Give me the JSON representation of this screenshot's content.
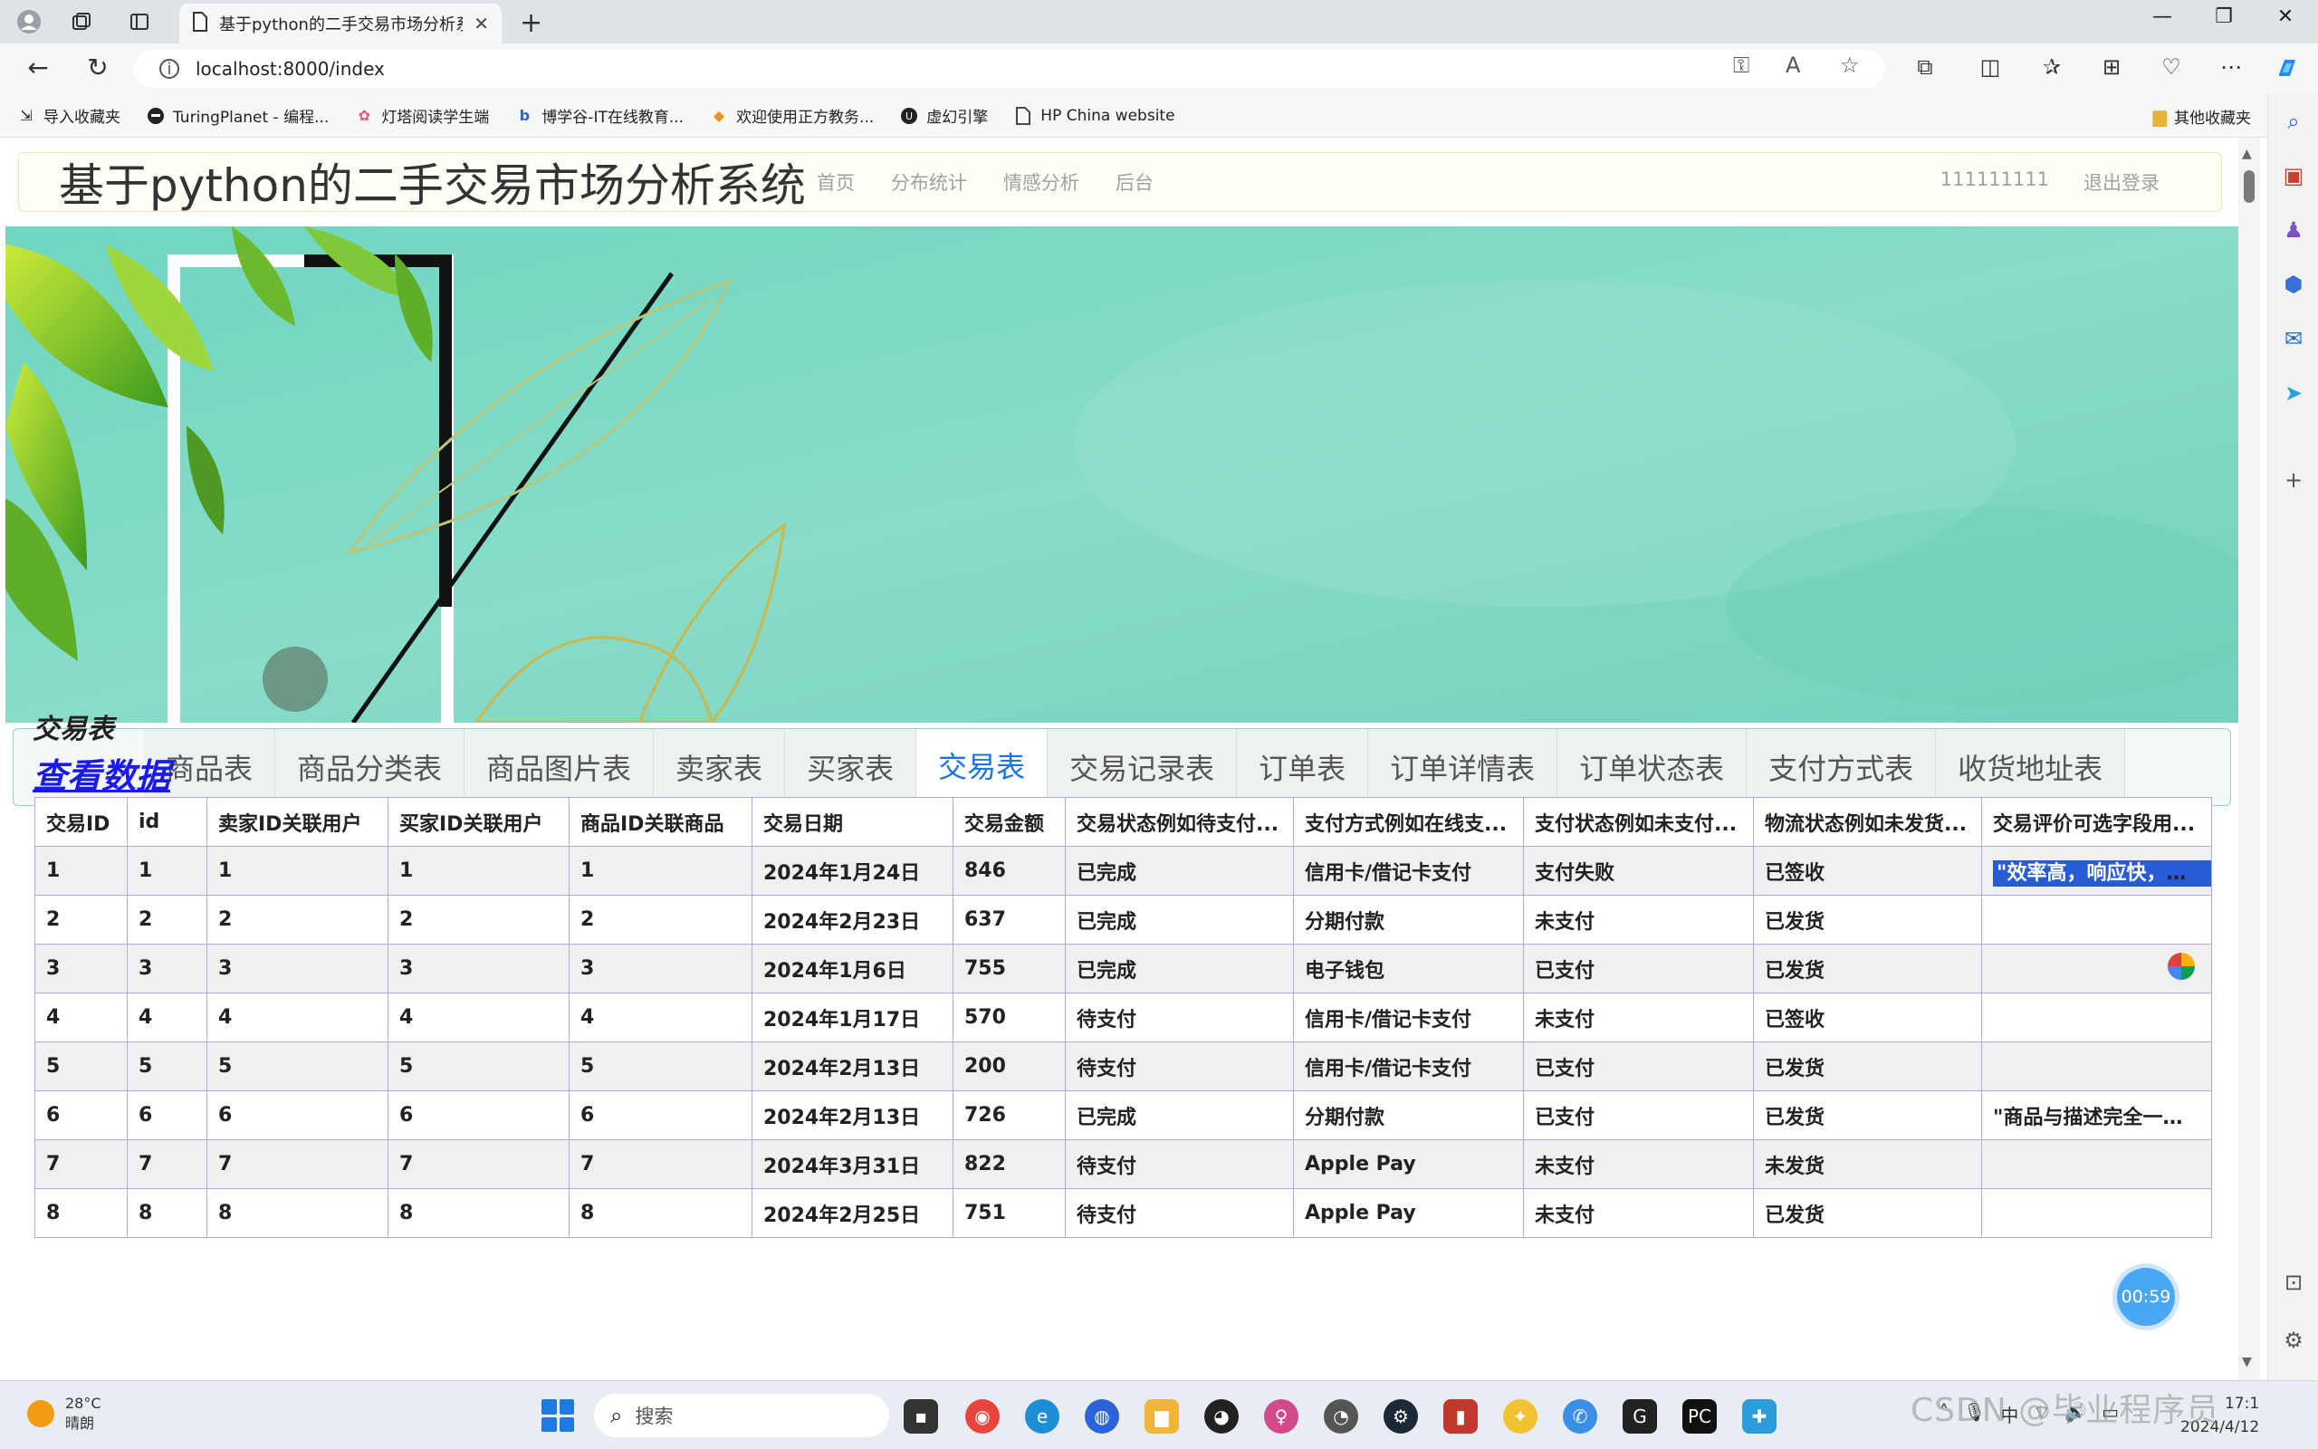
{
  "browser": {
    "tab_title": "基于python的二手交易市场分析系",
    "url": "localhost:8000/index",
    "bookmarks": [
      {
        "label": "导入收藏夹"
      },
      {
        "label": "TuringPlanet - 编程..."
      },
      {
        "label": "灯塔阅读学生端"
      },
      {
        "label": "博学谷-IT在线教育..."
      },
      {
        "label": "欢迎使用正方教务..."
      },
      {
        "label": "虚幻引擎"
      },
      {
        "label": "HP China website"
      }
    ],
    "other_bookmarks": "其他收藏夹"
  },
  "header": {
    "title": "基于python的二手交易市场分析系统",
    "nav": [
      "首页",
      "分布统计",
      "情感分析",
      "后台"
    ],
    "user": "111111111",
    "logout": "退出登录"
  },
  "tabs": [
    "商品表",
    "商品分类表",
    "商品图片表",
    "卖家表",
    "买家表",
    "交易表",
    "交易记录表",
    "订单表",
    "订单详情表",
    "订单状态表",
    "支付方式表",
    "收货地址表"
  ],
  "active_tab": "交易表",
  "section": {
    "title": "交易表",
    "link": "查看数据"
  },
  "table": {
    "headers": [
      "交易ID",
      "id",
      "卖家ID关联用户",
      "买家ID关联用户",
      "商品ID关联商品",
      "交易日期",
      "交易金额",
      "交易状态例如待支付...",
      "支付方式例如在线支...",
      "支付状态例如未支付...",
      "物流状态例如未发货...",
      "交易评价可选字段用..."
    ],
    "rows": [
      [
        "1",
        "1",
        "1",
        "1",
        "1",
        "2024年1月24日",
        "846",
        "已完成",
        "信用卡/借记卡支付",
        "支付失败",
        "已签收",
        "\"效率高，响应快，很..."
      ],
      [
        "2",
        "2",
        "2",
        "2",
        "2",
        "2024年2月23日",
        "637",
        "已完成",
        "分期付款",
        "未支付",
        "已发货",
        ""
      ],
      [
        "3",
        "3",
        "3",
        "3",
        "3",
        "2024年1月6日",
        "755",
        "已完成",
        "电子钱包",
        "已支付",
        "已发货",
        ""
      ],
      [
        "4",
        "4",
        "4",
        "4",
        "4",
        "2024年1月17日",
        "570",
        "待支付",
        "信用卡/借记卡支付",
        "未支付",
        "已签收",
        ""
      ],
      [
        "5",
        "5",
        "5",
        "5",
        "5",
        "2024年2月13日",
        "200",
        "待支付",
        "信用卡/借记卡支付",
        "已支付",
        "已发货",
        ""
      ],
      [
        "6",
        "6",
        "6",
        "6",
        "6",
        "2024年2月13日",
        "726",
        "已完成",
        "分期付款",
        "已支付",
        "已发货",
        "\"商品与描述完全一致..."
      ],
      [
        "7",
        "7",
        "7",
        "7",
        "7",
        "2024年3月31日",
        "822",
        "待支付",
        "Apple Pay",
        "未支付",
        "未发货",
        ""
      ],
      [
        "8",
        "8",
        "8",
        "8",
        "8",
        "2024年2月25日",
        "751",
        "待支付",
        "Apple Pay",
        "未支付",
        "已发货",
        ""
      ]
    ]
  },
  "timer": "00:59",
  "taskbar": {
    "weather_temp": "28°C",
    "weather_desc": "晴朗",
    "search_placeholder": "搜索",
    "ime": "中",
    "time": "17:1",
    "date": "2024/4/12"
  },
  "watermark": "CSDN @毕业程序员"
}
